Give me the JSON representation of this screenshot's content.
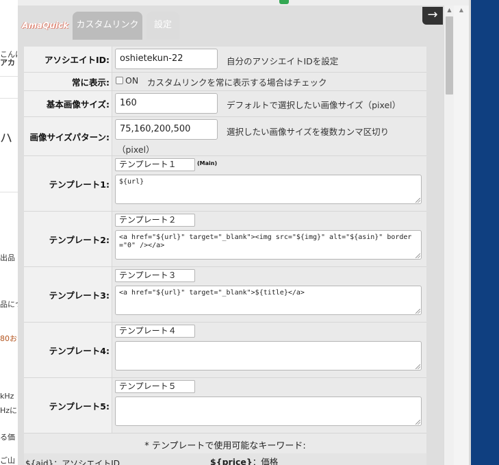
{
  "background_fragments": [
    "こんに",
    "アカ",
    "ハ",
    "出品",
    "品につ",
    "80お",
    "kHz",
    "Hzに",
    "る価",
    "ご山"
  ],
  "colors": {
    "window_bg": "#dedede",
    "content_bg": "#eaeaea",
    "right_band": "#0f3f80",
    "brand_outline": "#e08b7a"
  },
  "tabs": {
    "brand": "AmaQuick",
    "custom_link": "カスタムリンク",
    "settings": "設定"
  },
  "close_button": {
    "glyph": "→",
    "icon": "arrow-right-icon"
  },
  "settings": {
    "associate_id": {
      "label": "アソシエイトID:",
      "value": "oshietekun-22",
      "hint": "自分のアソシエイトIDを設定"
    },
    "always_show": {
      "label": "常に表示:",
      "checkbox_label": "ON",
      "hint": "カスタムリンクを常に表示する場合はチェック",
      "checked": false
    },
    "base_image_size": {
      "label": "基本画像サイズ:",
      "value": "160",
      "hint": "デフォルトで選択したい画像サイズ（pixel）"
    },
    "image_size_pattern": {
      "label": "画像サイズパターン:",
      "value": "75,160,200,500",
      "hint": "選択したい画像サイズを複数カンマ区切り",
      "hint2": "（pixel）"
    }
  },
  "templates": [
    {
      "label": "テンプレート1:",
      "name": "テンプレート１",
      "badge": "(Main)",
      "body": "${url}"
    },
    {
      "label": "テンプレート2:",
      "name": "テンプレート２",
      "badge": "",
      "body": "<a href=\"${url}\" target=\"_blank\"><img src=\"${img}\" alt=\"${asin}\" border=\"0\" /></a>"
    },
    {
      "label": "テンプレート3:",
      "name": "テンプレート３",
      "badge": "",
      "body": "<a href=\"${url}\" target=\"_blank\">${title}</a>"
    },
    {
      "label": "テンプレート4:",
      "name": "テンプレート４",
      "badge": "",
      "body": ""
    },
    {
      "label": "テンプレート5:",
      "name": "テンプレート５",
      "badge": "",
      "body": ""
    }
  ],
  "keywords": {
    "title": "* テンプレートで使用可能なキーワード:",
    "left": "${aid}：アソシエイトID",
    "right_key": "${price}",
    "right_desc": "：価格"
  }
}
